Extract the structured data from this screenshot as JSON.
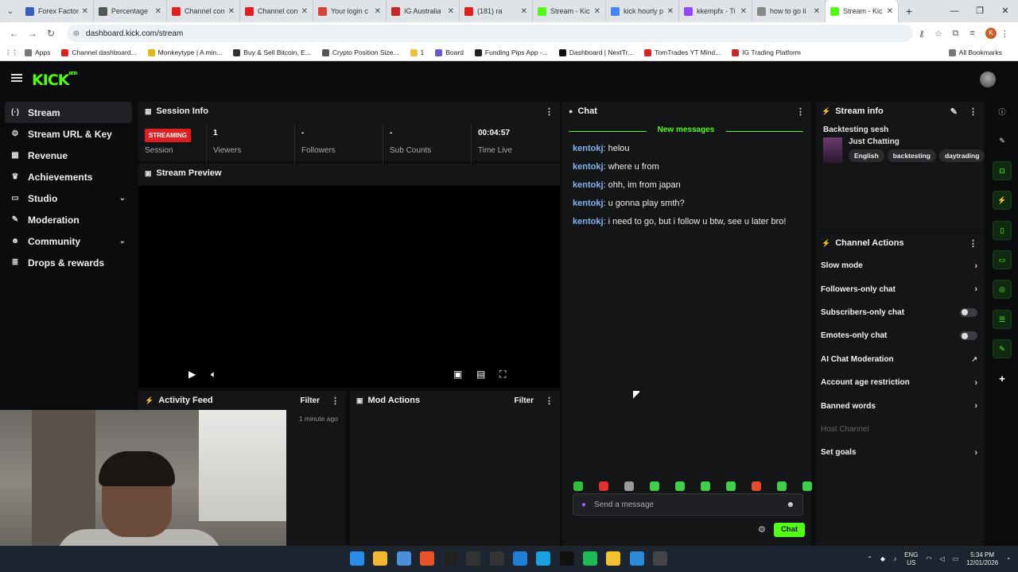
{
  "browser": {
    "tabs": [
      {
        "title": "Forex Factor",
        "color": "#3a5fb8"
      },
      {
        "title": "Percentage",
        "color": "#555555"
      },
      {
        "title": "Channel con",
        "color": "#e02020"
      },
      {
        "title": "Channel con",
        "color": "#e02020"
      },
      {
        "title": "Your login c",
        "color": "#d44638"
      },
      {
        "title": "IG Australia",
        "color": "#c62828"
      },
      {
        "title": "(181) ra",
        "color": "#e02020"
      },
      {
        "title": "Stream - Kic",
        "color": "#53fc18"
      },
      {
        "title": "kick hourly p",
        "color": "#4285f4"
      },
      {
        "title": "kkempfx - Ti",
        "color": "#9146ff"
      },
      {
        "title": "how to go li",
        "color": "#888888"
      },
      {
        "title": "Stream - Kic",
        "color": "#53fc18",
        "active": true
      }
    ],
    "url": "dashboard.kick.com/stream",
    "profile_initial": "K",
    "bookmarks": [
      {
        "label": "Apps",
        "color": "#777777"
      },
      {
        "label": "Channel dashboard...",
        "color": "#e02020"
      },
      {
        "label": "Monkeytype | A min...",
        "color": "#e2b714"
      },
      {
        "label": "Buy & Sell Bitcoin, E...",
        "color": "#333333"
      },
      {
        "label": "Crypto Position Size...",
        "color": "#555555"
      },
      {
        "label": "1",
        "color": "#f0c040"
      },
      {
        "label": "Board",
        "color": "#6a5acd"
      },
      {
        "label": "Funding Pips App -...",
        "color": "#222222"
      },
      {
        "label": "Dashboard | NextTr...",
        "color": "#111111"
      },
      {
        "label": "TomTrades YT Mind...",
        "color": "#e02020"
      },
      {
        "label": "IG Trading Platform",
        "color": "#c62828"
      }
    ],
    "all_bookmarks": "All Bookmarks"
  },
  "sidebar": {
    "items": [
      {
        "label": "Stream",
        "icon": "stream-icon",
        "glyph": "(·)",
        "active": true
      },
      {
        "label": "Stream URL & Key",
        "icon": "key-icon",
        "glyph": "⚙"
      },
      {
        "label": "Revenue",
        "icon": "revenue-icon",
        "glyph": "▦"
      },
      {
        "label": "Achievements",
        "icon": "trophy-icon",
        "glyph": "♛"
      },
      {
        "label": "Studio",
        "icon": "studio-icon",
        "glyph": "▭",
        "chevron": true
      },
      {
        "label": "Moderation",
        "icon": "wrench-icon",
        "glyph": "✎"
      },
      {
        "label": "Community",
        "icon": "community-icon",
        "glyph": "☻",
        "chevron": true
      },
      {
        "label": "Drops & rewards",
        "icon": "drops-icon",
        "glyph": "≣"
      }
    ]
  },
  "session": {
    "title": "Session Info",
    "status_badge": "STREAMING",
    "status_label": "Session",
    "stats": [
      {
        "value": "1",
        "label": "Viewers"
      },
      {
        "value": "-",
        "label": "Followers"
      },
      {
        "value": "-",
        "label": "Sub Counts"
      },
      {
        "value": "00:04:57",
        "label": "Time Live"
      }
    ]
  },
  "preview": {
    "title": "Stream Preview"
  },
  "activity": {
    "title": "Activity Feed",
    "filter": "Filter",
    "time_ago": "1 minute ago"
  },
  "mod": {
    "title": "Mod Actions",
    "filter": "Filter"
  },
  "chat": {
    "title": "Chat",
    "new_messages": "New messages",
    "messages": [
      {
        "user": "kentokj",
        "text": ": helou"
      },
      {
        "user": "kentokj",
        "text": ": where u from"
      },
      {
        "user": "kentokj",
        "text": ": ohh, im from japan"
      },
      {
        "user": "kentokj",
        "text": ": u gonna play smth?"
      },
      {
        "user": "kentokj",
        "text": ": i need to go, but i follow u btw, see u later bro!"
      }
    ],
    "emote_colors": [
      "#2fbf3a",
      "#e03030",
      "#9a9a9a",
      "#3fcf4a",
      "#3fcf4a",
      "#3fcf4a",
      "#3fcf4a",
      "#e84a30",
      "#3fcf4a",
      "#3fcf4a"
    ],
    "input_placeholder": "Send a message",
    "send_label": "Chat"
  },
  "stream_info": {
    "title": "Stream info",
    "stream_title": "Backtesting sesh",
    "category": "Just Chatting",
    "tags": [
      "English",
      "backtesting",
      "daytrading"
    ]
  },
  "channel_actions": {
    "title": "Channel Actions",
    "items": [
      {
        "label": "Slow mode",
        "control": "arrow"
      },
      {
        "label": "Followers-only chat",
        "control": "arrow"
      },
      {
        "label": "Subscribers-only chat",
        "control": "toggle"
      },
      {
        "label": "Emotes-only chat",
        "control": "toggle"
      },
      {
        "label": "AI Chat Moderation",
        "control": "external"
      },
      {
        "label": "Account age restriction",
        "control": "arrow"
      },
      {
        "label": "Banned words",
        "control": "arrow"
      },
      {
        "label": "Host Channel",
        "control": "none",
        "disabled": true
      },
      {
        "label": "Set goals",
        "control": "arrow"
      }
    ]
  },
  "taskbar": {
    "icon_colors": [
      "#2b8ce8",
      "#f2b630",
      "#4a90d9",
      "#e8542c",
      "#222222",
      "#333333",
      "#333333",
      "#1f7fd4",
      "#1a9fe0",
      "#111111",
      "#1db954",
      "#f2c230",
      "#2a8ad8",
      "#444444"
    ],
    "lang": "ENG",
    "region": "US",
    "time": "5:34 PM",
    "date": "12/01/2026"
  }
}
